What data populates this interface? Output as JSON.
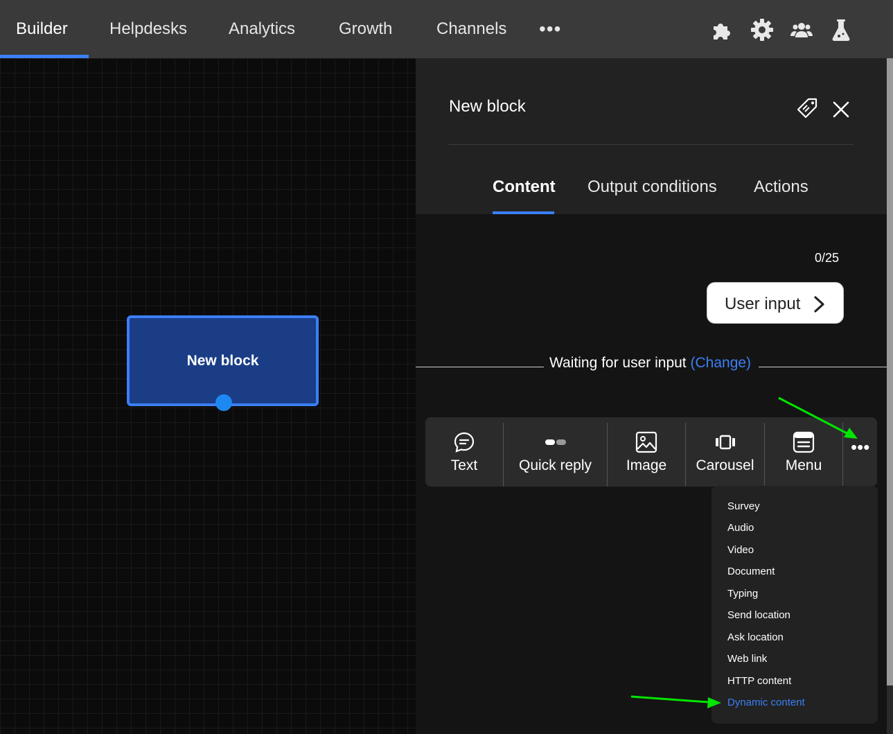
{
  "nav": {
    "tabs": [
      "Builder",
      "Helpdesks",
      "Analytics",
      "Growth",
      "Channels"
    ],
    "more_label": "•••",
    "icons": [
      "puzzle-icon",
      "gear-icon",
      "users-icon",
      "flask-icon"
    ]
  },
  "canvas": {
    "node_label": "New block"
  },
  "panel": {
    "title": "New block",
    "tabs": [
      "Content",
      "Output conditions",
      "Actions"
    ],
    "active_tab": "Content",
    "counter": "0/25",
    "user_input_button": "User input",
    "waiting_text": "Waiting for user input",
    "change_link": "(Change)"
  },
  "toolbar": {
    "items": [
      "Text",
      "Quick reply",
      "Image",
      "Carousel",
      "Menu"
    ],
    "more_label": "•••"
  },
  "dropdown": {
    "items": [
      "Survey",
      "Audio",
      "Video",
      "Document",
      "Typing",
      "Send location",
      "Ask location",
      "Web link",
      "HTTP content",
      "Dynamic content"
    ],
    "highlighted": "Dynamic content"
  },
  "colors": {
    "accent": "#3b7ff5",
    "node_fill": "#1a3d86",
    "annotation_arrow": "#00e600"
  }
}
